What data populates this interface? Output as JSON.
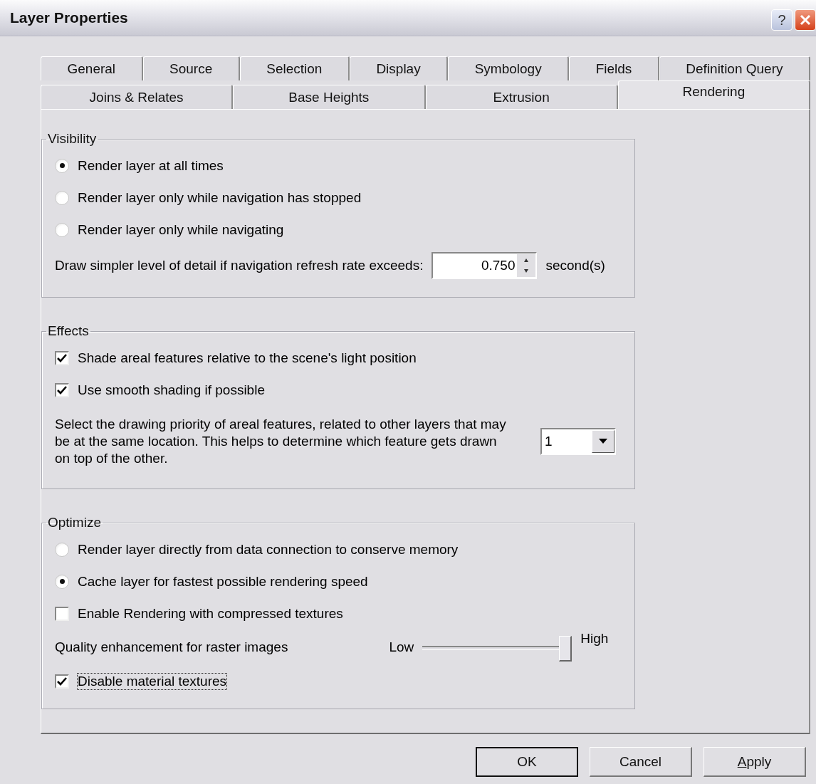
{
  "window": {
    "title": "Layer Properties",
    "help_button": "?"
  },
  "tab_rows": [
    {
      "tabs": [
        {
          "label": "General",
          "selected": false
        },
        {
          "label": "Source",
          "selected": false
        },
        {
          "label": "Selection",
          "selected": false
        },
        {
          "label": "Display",
          "selected": false
        },
        {
          "label": "Symbology",
          "selected": false
        },
        {
          "label": "Fields",
          "selected": false
        },
        {
          "label": "Definition Query",
          "selected": false
        }
      ]
    },
    {
      "tabs": [
        {
          "label": "Joins & Relates",
          "selected": false
        },
        {
          "label": "Base Heights",
          "selected": false
        },
        {
          "label": "Extrusion",
          "selected": false
        },
        {
          "label": "Rendering",
          "selected": true
        }
      ]
    }
  ],
  "groups": [
    {
      "title": "Visibility",
      "items": [
        {
          "kind": "radio",
          "label": "Render layer at all times",
          "selected": true
        },
        {
          "kind": "radio",
          "label": "Render layer only while navigation has stopped",
          "selected": false
        },
        {
          "kind": "radio",
          "label": "Render layer only while navigating",
          "selected": false
        },
        {
          "kind": "spinner",
          "label": "Draw simpler level of detail if navigation refresh rate exceeds:",
          "value": "0.750",
          "unit": "second(s)"
        }
      ]
    },
    {
      "title": "Effects",
      "items": [
        {
          "kind": "checkbox",
          "label": "Shade areal features relative to the scene's light position",
          "checked": true
        },
        {
          "kind": "checkbox",
          "label": "Use smooth shading if possible",
          "checked": true
        },
        {
          "kind": "dropdown",
          "label": "Select the drawing priority of areal features, related to other layers that may be at the same location. This helps to determine which feature gets drawn on top of the other.",
          "value": "1"
        }
      ]
    },
    {
      "title": "Optimize",
      "items": [
        {
          "kind": "radio",
          "label": "Render layer directly from data connection to conserve memory",
          "selected": false
        },
        {
          "kind": "radio",
          "label": "Cache layer for fastest possible rendering speed",
          "selected": true
        },
        {
          "kind": "checkbox",
          "label": "Enable Rendering with compressed textures",
          "checked": false
        },
        {
          "kind": "slider",
          "label": "Quality enhancement for raster images",
          "min_label": "Low",
          "max_label": "High",
          "level": 1
        },
        {
          "kind": "checkbox",
          "label": "Disable material textures",
          "checked": true,
          "focused": true
        }
      ]
    }
  ],
  "buttons": [
    {
      "label": "OK",
      "default": true
    },
    {
      "label": "Cancel",
      "default": false
    },
    {
      "label": "Apply",
      "default": false
    }
  ]
}
